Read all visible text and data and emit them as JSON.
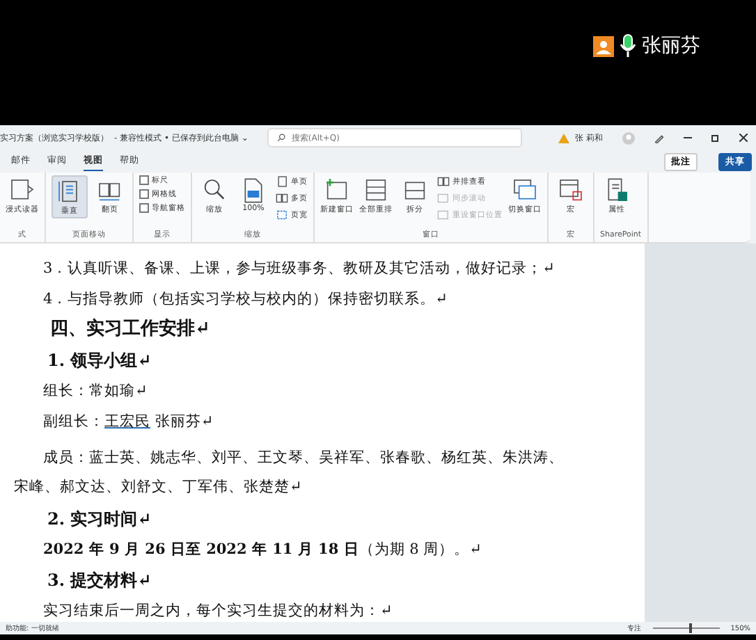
{
  "speaker": {
    "name": "张丽芬"
  },
  "window": {
    "title": "实习方案（浏览实习学校版）",
    "status": "- 兼容性模式 • 已保存到此台电脑 ⌄",
    "search": {
      "placeholder": "搜索(Alt+Q)"
    },
    "user": "张 莉和"
  },
  "tabs": [
    {
      "label": "邮件",
      "selected": false
    },
    {
      "label": "审阅",
      "selected": false
    },
    {
      "label": "视图",
      "selected": true
    },
    {
      "label": "帮助",
      "selected": false
    }
  ],
  "actions": [
    {
      "label": "批注",
      "kind": "outline"
    },
    {
      "label": "共享",
      "kind": "primary"
    }
  ],
  "ribbon": [
    {
      "label": "式",
      "items": [
        {
          "kind": "large",
          "label": "浸式读器",
          "disabled": false,
          "selected": false
        }
      ]
    },
    {
      "label": "页面移动",
      "items": [
        {
          "kind": "large",
          "label": "垂直",
          "disabled": false,
          "selected": true
        },
        {
          "kind": "large",
          "label": "翻页",
          "disabled": false,
          "selected": false
        }
      ]
    },
    {
      "label": "显示",
      "items": [
        {
          "kind": "check",
          "label": "标尺",
          "checked": false,
          "disabled": false
        },
        {
          "kind": "check",
          "label": "网格线",
          "checked": false,
          "disabled": false
        },
        {
          "kind": "check",
          "label": "导航窗格",
          "checked": false,
          "disabled": false
        }
      ]
    },
    {
      "label": "缩放",
      "items": [
        {
          "kind": "large",
          "label": "缩放",
          "disabled": false
        },
        {
          "kind": "large",
          "label": "100%",
          "disabled": false
        },
        {
          "kind": "small",
          "label": "单页",
          "disabled": false
        },
        {
          "kind": "small",
          "label": "多页",
          "disabled": false
        },
        {
          "kind": "small",
          "label": "页宽",
          "disabled": false
        }
      ]
    },
    {
      "label": "窗口",
      "items": [
        {
          "kind": "large",
          "label": "新建窗口",
          "disabled": false
        },
        {
          "kind": "large",
          "label": "全部重排",
          "disabled": false
        },
        {
          "kind": "large",
          "label": "拆分",
          "disabled": false
        },
        {
          "kind": "small",
          "label": "并排查看",
          "disabled": false
        },
        {
          "kind": "small",
          "label": "同步滚动",
          "disabled": true
        },
        {
          "kind": "small",
          "label": "重设窗口位置",
          "disabled": true
        },
        {
          "kind": "large",
          "label": "切换窗口",
          "disabled": false
        }
      ]
    },
    {
      "label": "宏",
      "items": [
        {
          "kind": "large",
          "label": "宏",
          "disabled": false
        }
      ]
    },
    {
      "label": "SharePoint",
      "items": [
        {
          "kind": "large",
          "label": "属性",
          "disabled": false
        }
      ]
    }
  ],
  "document": [
    {
      "kind": "para",
      "text": "3．认真听课、备课、上课，参与班级事务、教研及其它活动，做好记录；↵"
    },
    {
      "kind": "para",
      "text": "4．与指导教师（包括实习学校与校内的）保持密切联系。↵"
    },
    {
      "kind": "heading1",
      "text": "四、实习工作安排↵"
    },
    {
      "kind": "heading2",
      "text": "1.  领导小组↵"
    },
    {
      "kind": "para",
      "text": "组长：常如瑜↵"
    },
    {
      "kind": "names",
      "label": "副组长：",
      "names": [
        {
          "text": "王宏民",
          "flagged": true
        },
        {
          "text": "张丽芬↵",
          "flagged": false
        }
      ]
    },
    {
      "kind": "members",
      "text": "成员：蓝士英、姚志华、刘平、王文琴、吴祥军、张春歌、杨红英、朱洪涛、宋峰、郝文达、刘舒文、丁军伟、张楚楚↵"
    },
    {
      "kind": "heading2",
      "text": "2.  实习时间↵"
    },
    {
      "kind": "para",
      "text": "**2022 年 9 月 26 日至 2022 年 11 月 18 日**（为期 8 周）。↵"
    },
    {
      "kind": "heading2",
      "text": "3.  提交材料↵"
    },
    {
      "kind": "para",
      "text": "实习结束后一周之内，每个实习生提交的材料为：↵"
    }
  ],
  "status_bar": {
    "left": "助功能: 一切就绪",
    "focus": "专注",
    "zoom": {
      "level": 0.55,
      "reading": "150%"
    }
  }
}
